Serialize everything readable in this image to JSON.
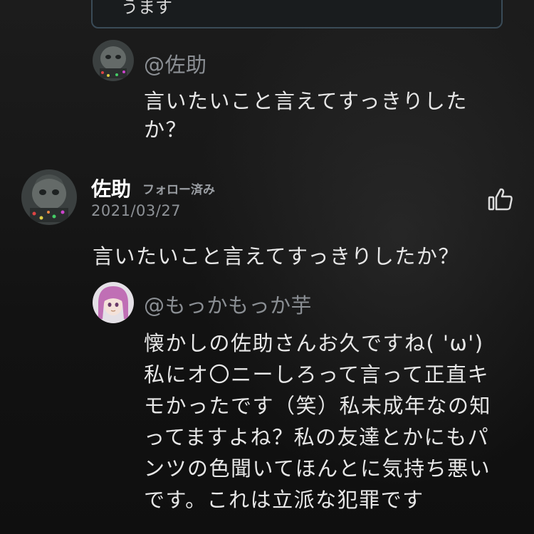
{
  "quoted_comment": {
    "text_fragment": "うます"
  },
  "thread_reply": {
    "handle": "@佐助",
    "text": "言いたいこと言えてすっきりした\nか？"
  },
  "main_comment": {
    "author": "佐助",
    "follow_status": "フォロー済み",
    "date": "2021/03/27",
    "text": "言いたいこと言えてすっきりしたか？",
    "like_icon": "thumbs-up-icon"
  },
  "reply": {
    "handle": "@もっかもっか芋",
    "text": "懐かしの佐助さんお久ですね( 'ω')\n私にオ〇ニーしろって言って正直キ\nモかったです（笑）私未成年なの知\nってますよね？私の友達とかにもパ\nンツの色聞いてほんとに気持ち悪い\nです。これは立派な犯罪です"
  },
  "colors": {
    "background": "#141414",
    "text_primary": "#e7e7e7",
    "text_secondary": "#8b8f94",
    "quote_border": "#3a4b57"
  }
}
